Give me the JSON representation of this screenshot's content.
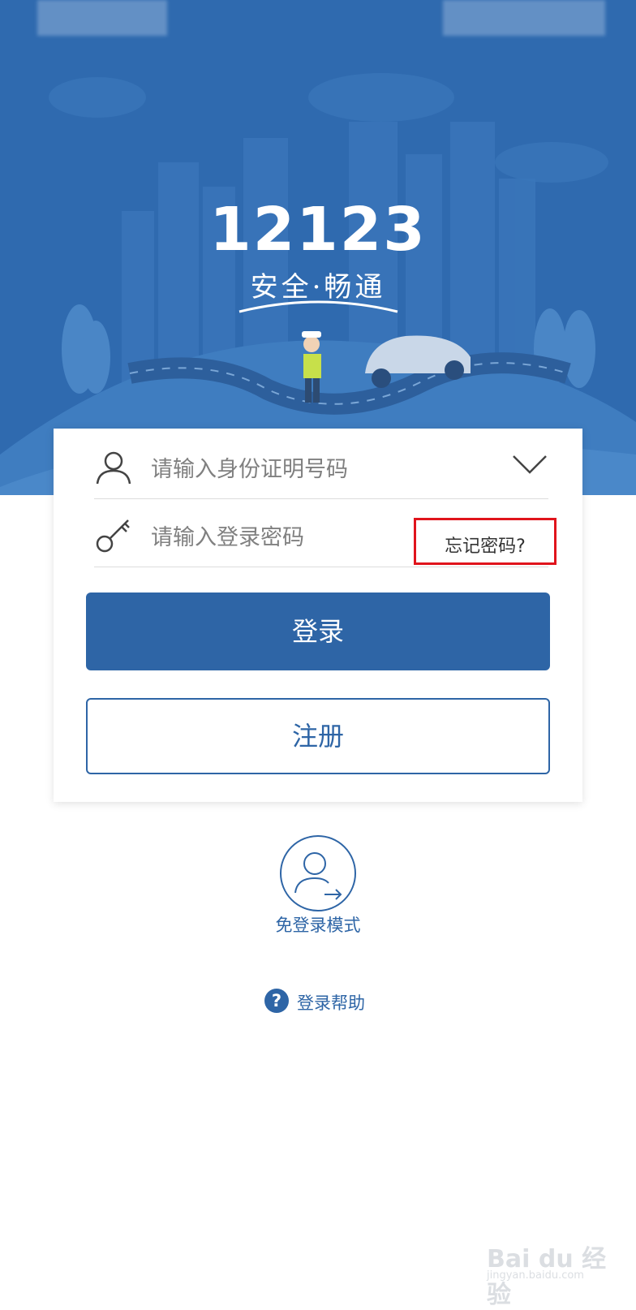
{
  "hero": {
    "logo_number": "12123",
    "slogan": "安全·畅通"
  },
  "login_form": {
    "id_placeholder": "请输入身份证明号码",
    "password_placeholder": "请输入登录密码",
    "forgot_password": "忘记密码?",
    "login_button": "登录",
    "register_button": "注册"
  },
  "guest_mode": {
    "label": "免登录模式"
  },
  "help": {
    "label": "登录帮助"
  },
  "watermark": {
    "brand": "Bai du 经验",
    "url": "jingyan.baidu.com"
  },
  "colors": {
    "header_blue": "#2f6aaf",
    "button_blue": "#2e65a6",
    "highlight_red": "#e0141c"
  }
}
